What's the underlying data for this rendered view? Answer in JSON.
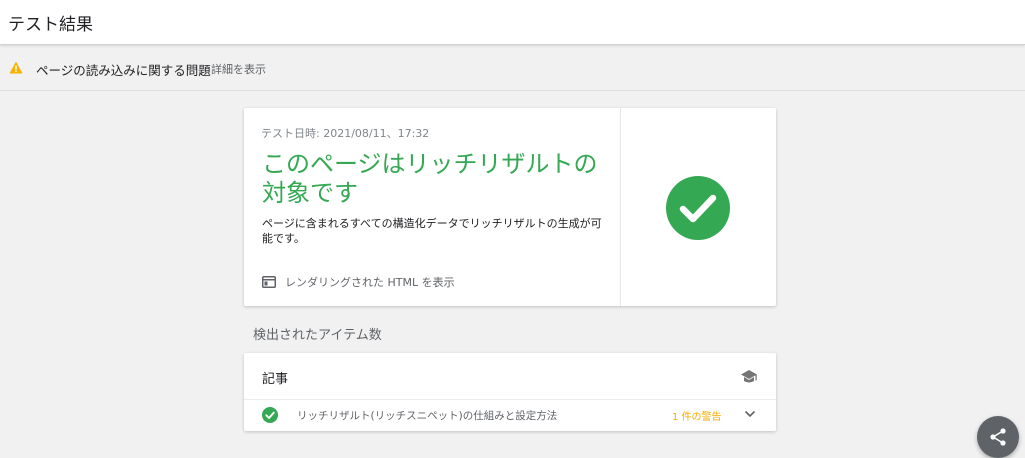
{
  "header": {
    "title": "テスト結果"
  },
  "warning": {
    "icon": "warning-icon",
    "text": "ページの読み込みに関する問題",
    "link": "詳細を表示",
    "color": "#f4b400"
  },
  "result": {
    "test_date": "テスト日時: 2021/08/11、17:32",
    "title": "このページはリッチリザルトの対象です",
    "description": "ページに含まれるすべての構造化データでリッチリザルトの生成が可能です。",
    "render_link_icon": "web-page-icon",
    "render_link_label": "レンダリングされた HTML を表示",
    "status_icon": "check-circle-icon",
    "status_color": "#34a853"
  },
  "detected": {
    "section_title": "検出されたアイテム数",
    "card_title": "記事",
    "card_icon": "school-cap-icon",
    "items": [
      {
        "icon": "check-circle-icon",
        "label": "リッチリザルト(リッチスニペット)の仕組みと設定方法",
        "warning": "1 件の警告",
        "warning_color": "#f9ab00"
      }
    ]
  },
  "fab": {
    "icon": "share-icon"
  }
}
